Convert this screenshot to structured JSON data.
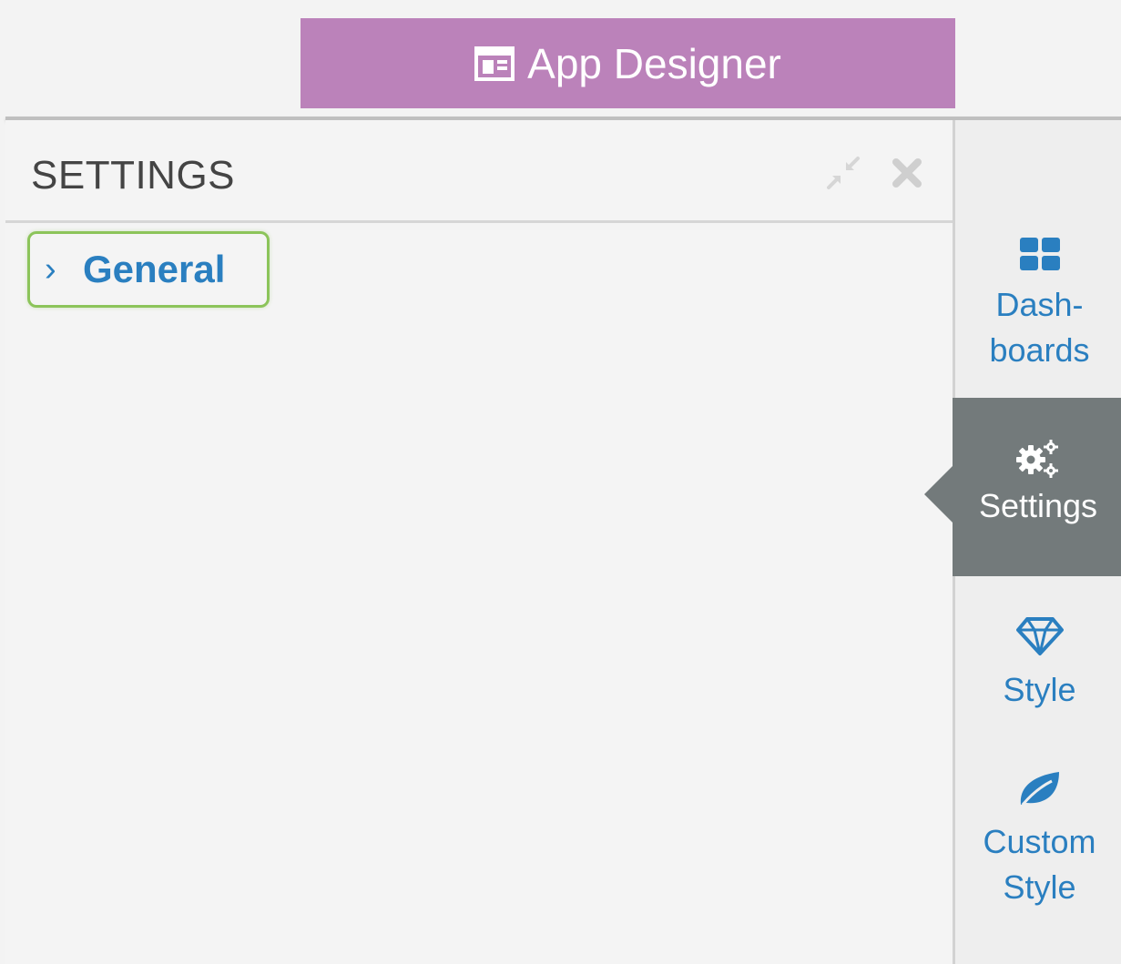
{
  "header": {
    "title": "App Designer",
    "accent_color": "#bb82ba",
    "icon": "app-layout-icon"
  },
  "panel": {
    "title": "SETTINGS",
    "collapse_icon": "compress-icon",
    "close_icon": "close-icon",
    "items": [
      {
        "label": "General",
        "icon": "chevron-right-icon",
        "chevron": "›",
        "highlighted": true,
        "highlight_color": "#8cc45a"
      }
    ]
  },
  "rail": {
    "items": [
      {
        "label_line1": "Dash-",
        "label_line2": "boards",
        "icon": "dashboards-icon",
        "active": false
      },
      {
        "label": "Settings",
        "icon": "gears-icon",
        "active": true
      },
      {
        "label": "Style",
        "icon": "diamond-icon",
        "active": false
      },
      {
        "label_line1": "Custom",
        "label_line2": "Style",
        "icon": "leaf-icon",
        "active": false
      }
    ],
    "link_color": "#2a7fc0",
    "active_bg": "#737a7b"
  }
}
